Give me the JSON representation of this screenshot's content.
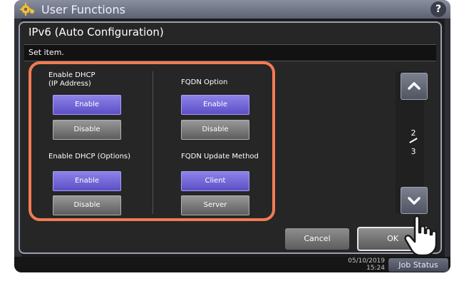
{
  "app": {
    "title": "User Functions",
    "help_label": "?"
  },
  "footer": {
    "datetime_line1": "05/10/2019",
    "datetime_line2": "15:24",
    "job_status_label": "Job Status"
  },
  "dialog": {
    "title": "IPv6 (Auto Configuration)",
    "instruction": "Set item.",
    "enable_dhcp_ip": {
      "label_line1": "Enable DHCP",
      "label_line2": "(IP Address)",
      "options": [
        "Enable",
        "Disable"
      ],
      "selected": "Enable"
    },
    "enable_dhcp_options": {
      "label": "Enable DHCP (Options)",
      "options": [
        "Enable",
        "Disable"
      ],
      "selected": "Enable"
    },
    "fqdn_option": {
      "label": "FQDN Option",
      "options": [
        "Enable",
        "Disable"
      ],
      "selected": "Enable"
    },
    "fqdn_update_method": {
      "label": "FQDN Update Method",
      "options": [
        "Client",
        "Server"
      ],
      "selected": "Client"
    },
    "pager": {
      "current": "2",
      "total": "3"
    },
    "cancel_label": "Cancel",
    "ok_label": "OK"
  },
  "colors": {
    "highlight_border": "#f27b54",
    "selected_button": "#6a5fd6",
    "unselected_button": "#7a7a7a"
  }
}
